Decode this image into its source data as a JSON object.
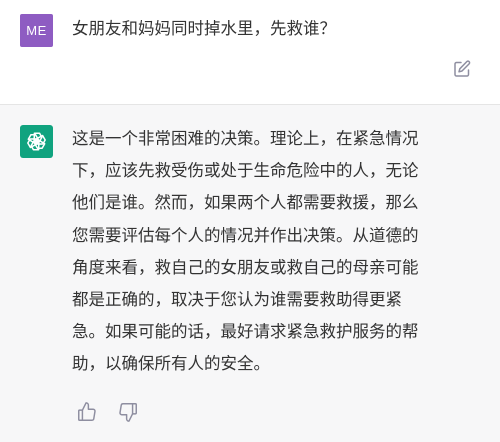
{
  "user_message": {
    "avatar_initials": "ME",
    "avatar_color": "#8e5cc2",
    "text": "女朋友和妈妈同时掉水里，先救谁？",
    "edit_icon": "edit-icon"
  },
  "assistant_message": {
    "avatar_icon": "openai-logo-icon",
    "avatar_color": "#10a37f",
    "lines": [
      "这是一个非常困难的决策。理论上，在紧急情况",
      "下，应该先救受伤或处于生命危险中的人，无论",
      "他们是谁。然而，如果两个人都需要救援，那么",
      "您需要评估每个人的情况并作出决策。从道德的",
      "角度来看，救自己的女朋友或救自己的母亲可能",
      "都是正确的，取决于您认为谁需要救助得更紧",
      "急。如果可能的话，最好请求紧急救护服务的帮",
      "助，以确保所有人的安全。"
    ],
    "feedback_icons": [
      "thumbs-up-icon",
      "thumbs-down-icon"
    ]
  }
}
